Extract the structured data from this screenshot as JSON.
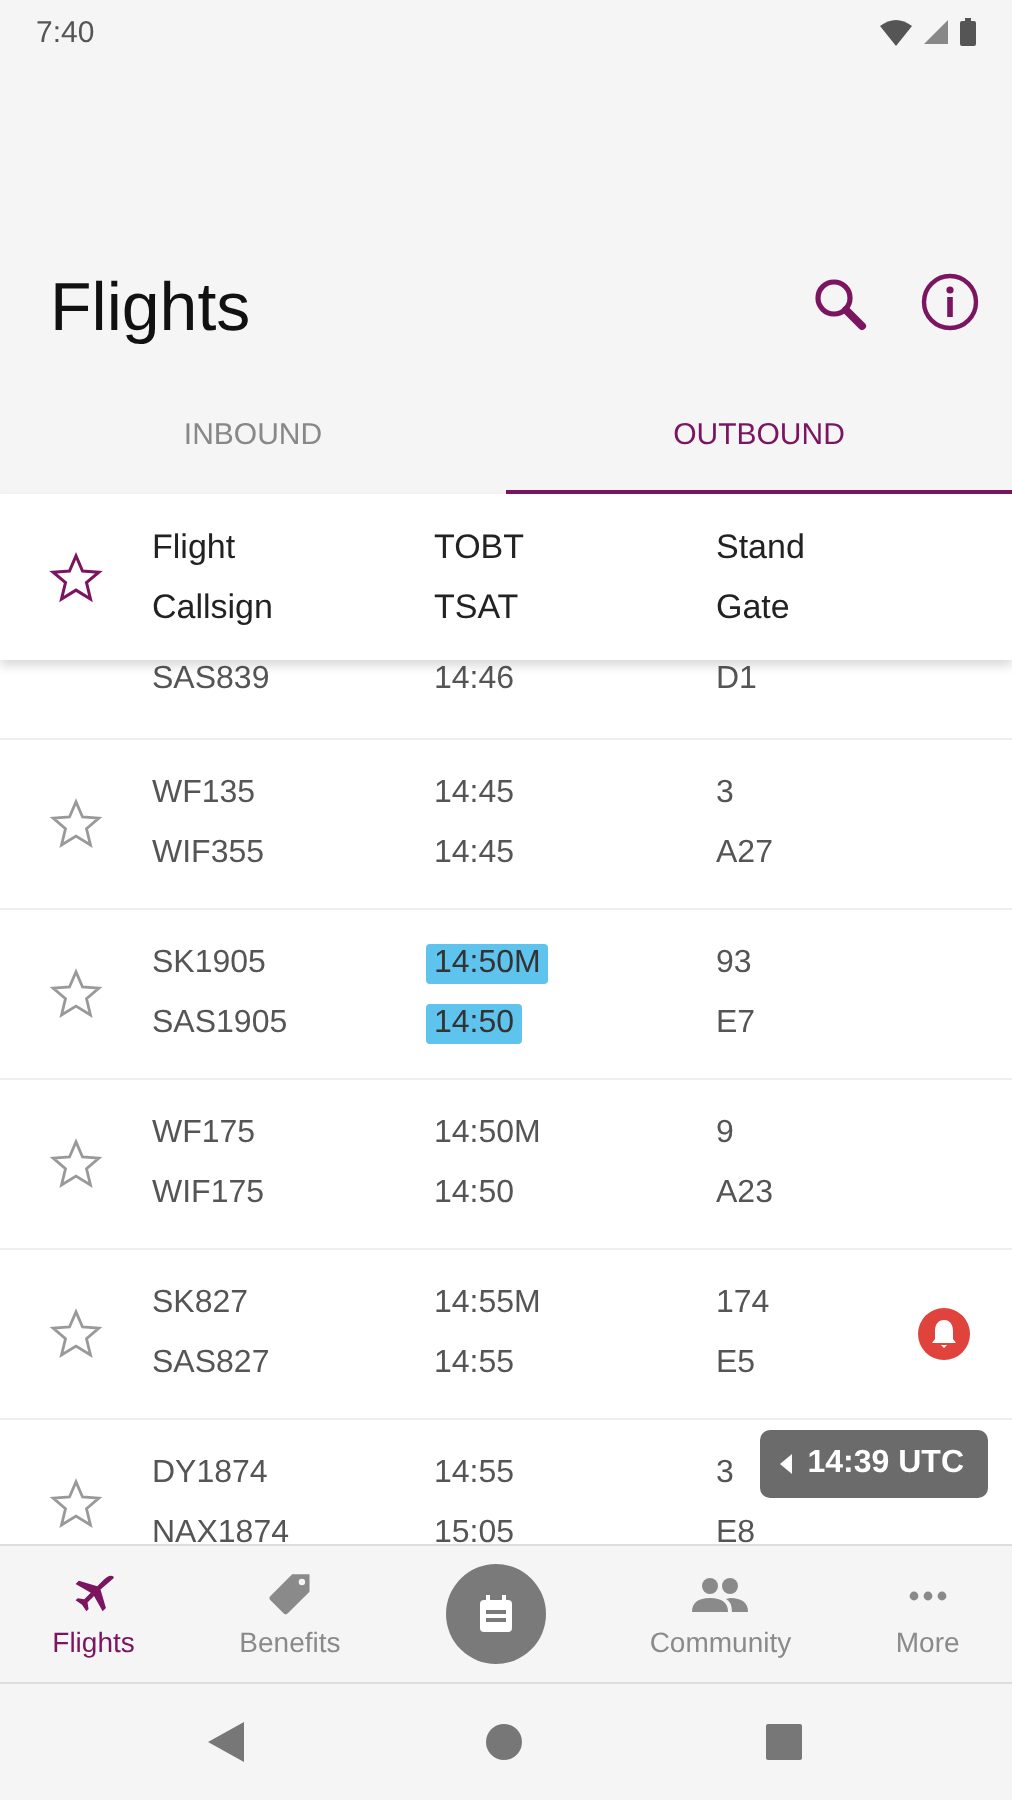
{
  "status_bar": {
    "time": "7:40"
  },
  "title": "Flights",
  "tabs": [
    {
      "label": "INBOUND",
      "selected": false
    },
    {
      "label": "OUTBOUND",
      "selected": true
    }
  ],
  "table": {
    "columns": [
      {
        "line_1": "Flight",
        "line_2": "Callsign"
      },
      {
        "line_1": "TOBT",
        "line_2": "TSAT"
      },
      {
        "line_1": "Stand",
        "line_2": "Gate"
      }
    ],
    "rows": [
      {
        "callsign": "SAS839",
        "tsat": "14:46",
        "gate": "D1"
      },
      {
        "flight": "WF135",
        "callsign": "WIF355",
        "tobt": "14:45",
        "tsat": "14:45",
        "stand": "3",
        "gate": "A27",
        "highlighted": false,
        "alert": false
      },
      {
        "flight": "SK1905",
        "callsign": "SAS1905",
        "tobt": "14:50M",
        "tsat": "14:50",
        "stand": "93",
        "gate": "E7",
        "highlighted": true,
        "alert": false
      },
      {
        "flight": "WF175",
        "callsign": "WIF175",
        "tobt": "14:50M",
        "tsat": "14:50",
        "stand": "9",
        "gate": "A23",
        "highlighted": false,
        "alert": false
      },
      {
        "flight": "SK827",
        "callsign": "SAS827",
        "tobt": "14:55M",
        "tsat": "14:55",
        "stand": "174",
        "gate": "E5",
        "highlighted": false,
        "alert": true
      },
      {
        "flight": "DY1874",
        "callsign": "NAX1874",
        "tobt": "14:55",
        "tsat": "15:05",
        "stand": "3",
        "gate": "E8",
        "highlighted": false,
        "alert": false
      }
    ]
  },
  "time_badge": "14:39 UTC",
  "bottom_nav": [
    {
      "kind": "flights",
      "label": "Flights",
      "selected": true
    },
    {
      "kind": "benefits",
      "label": "Benefits",
      "selected": false
    },
    {
      "kind": "calendar"
    },
    {
      "kind": "community",
      "label": "Community",
      "selected": false
    },
    {
      "kind": "more",
      "label": "More",
      "selected": false
    }
  ]
}
